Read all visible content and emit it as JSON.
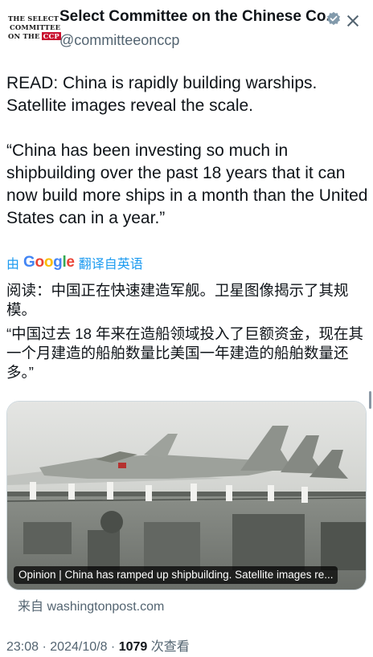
{
  "account": {
    "display_name": "Select Committee on the Chinese Co...",
    "handle": "@committeeonccp",
    "avatar_lines": [
      "THE SELECT",
      "COMMITTEE",
      "ON THE",
      "CCP"
    ],
    "verified": true
  },
  "tweet": {
    "text_en": [
      "READ: China is rapidly building warships. Satellite images reveal the scale.",
      "“China has been investing so much in shipbuilding over the past 18 years that it can now build more ships in a month than the United States can in a year.”"
    ],
    "translate_prefix": "由",
    "translate_suffix": "翻译自英语",
    "text_zh": [
      "阅读：中国正在快速建造军舰。卫星图像揭示了其规模。",
      "“中国过去 18 年来在造船领域投入了巨额资金，现在其一个月建造的船舶数量比美国一年建造的船舶数量还多。”"
    ]
  },
  "link_card": {
    "caption": "Opinion | China has ramped up shipbuilding. Satellite images re...",
    "source": "来自 washingtonpost.com"
  },
  "meta": {
    "time": "23:08",
    "date": "2024/10/8",
    "views": "1079",
    "views_label": "次查看",
    "separator": "·"
  },
  "icons": {
    "verified": "verified-badge-icon",
    "close": "close-icon"
  },
  "colors": {
    "accent": "#1d9bf0",
    "secondary_text": "#536471"
  }
}
